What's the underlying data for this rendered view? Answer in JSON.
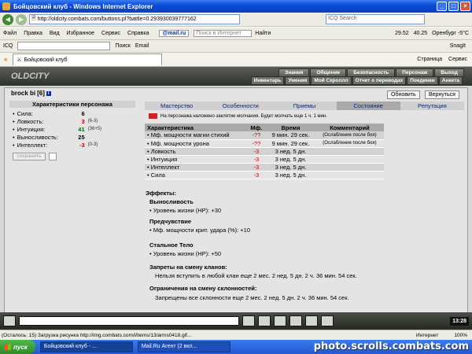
{
  "window": {
    "title": "Бойцовский клуб - Windows Internet Explorer"
  },
  "address": {
    "url": "http://oldcity.combats.com/buttons.pl?battle=0.293930039777162",
    "search_placeholder": "ICQ Search"
  },
  "menu": {
    "items": [
      "Файл",
      "Правка",
      "Вид",
      "Избранное",
      "Сервис",
      "Справка"
    ],
    "mailru": "@mail.ru",
    "search_placeholder": "Поиск в Интернет",
    "find": "Найти",
    "weather": [
      "29.52",
      "40.25",
      "Оренбург -5°C"
    ]
  },
  "toolbar3": {
    "icq": "ICQ",
    "search": "Поиск",
    "email": "Email",
    "snagit": "SnagIt"
  },
  "tab": {
    "title": "Бойцовский клуб",
    "page": "Страница",
    "tools": "Сервис"
  },
  "game": {
    "logo": "OLDCITY",
    "top_menu": [
      "Знания",
      "Общение",
      "Безопасность",
      "Персонаж",
      "Выход"
    ],
    "sub_menu": [
      "Инвентарь",
      "Умения",
      "Мой Скроллл",
      "Отчет о переводах",
      "Поединки",
      "Анкета"
    ],
    "character": {
      "name": "brock bi",
      "level": "[6]",
      "badge": "i"
    },
    "buttons": {
      "refresh": "Обновить",
      "back": "Вернуться",
      "save": "сохранить"
    },
    "left_header": "Характеристики персонажа",
    "stats": [
      {
        "name": "Сила:",
        "value": "6",
        "extra": "",
        "color": "#000000"
      },
      {
        "name": "Ловкость:",
        "value": "3",
        "extra": "(6-3)",
        "color": "#c00000"
      },
      {
        "name": "Интуиция:",
        "value": "41",
        "extra": "(36+5)",
        "color": "#007000"
      },
      {
        "name": "Выносливость:",
        "value": "25",
        "extra": "",
        "color": "#000000"
      },
      {
        "name": "Интеллект:",
        "value": "-3",
        "extra": "(0-3)",
        "color": "#c00000"
      }
    ],
    "tabs": [
      "Мастерство",
      "Особенности",
      "Приемы",
      "Состояние",
      "Репутация"
    ],
    "notice": "На персонажа наложено заклятие молчания. Будет молчать еще 1 ч. 1 мин.",
    "table": {
      "headers": [
        "Характеристика",
        "Мф.",
        "Время",
        "Комментарий"
      ],
      "rows": [
        [
          "• Мф. мощности магии стихий",
          "-??",
          "9 мин. 29 сек.",
          "(Ослабление после боя)"
        ],
        [
          "• Мф. мощности урона",
          "-??",
          "9 мин. 29 сек.",
          "(Ослабление после боя)"
        ],
        [
          "• Ловкость",
          "-3",
          "3 нед. 5 дн.",
          ""
        ],
        [
          "• Интуиция",
          "-3",
          "3 нед. 5 дн.",
          ""
        ],
        [
          "• Интеллект",
          "-3",
          "3 нед. 5 дн.",
          ""
        ],
        [
          "• Сила",
          "-3",
          "3 нед. 5 дн.",
          ""
        ]
      ]
    },
    "effects": {
      "heading": "Эффекты:",
      "blocks": [
        {
          "title": "Выносливость",
          "line": "• Уровень жизни (HP): +30"
        },
        {
          "title": "Предчувствие",
          "line": "• Мф. мощности крит. удара (%): +10"
        },
        {
          "title": "Стальное Тело",
          "line": "• Уровень жизни (HP): +50"
        },
        {
          "title": "Запреты на смену кланов:",
          "line": "Нельзя вступить в любой клан еще 2 мес. 2 нед. 5 дн. 2 ч. 36 мин. 54 сек."
        },
        {
          "title": "Ограничения на смену склонностей:",
          "line": "Запрещены все склонности еще 2 мес. 2 нед. 5 дн. 2 ч. 36 мин. 54 сек."
        }
      ]
    },
    "clock": "13:28"
  },
  "status": {
    "text": "(Осталось: 15) Загрузка рисунка http://img.combats.com/i/items/13/arms0418.gif...",
    "zone": "Интернет",
    "zoom": "100%"
  },
  "taskbar": {
    "start": "пуск",
    "items": [
      "Бойцовский клуб - ...",
      "Mail.Ru Агент (2 вкл..."
    ],
    "watermark": "photo.scrolls.combats.com"
  }
}
